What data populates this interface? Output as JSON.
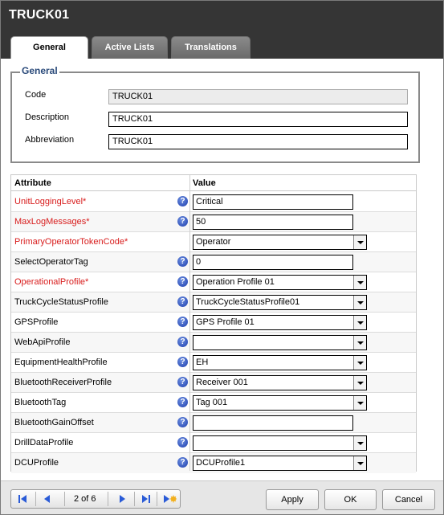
{
  "window": {
    "title": "TRUCK01"
  },
  "tabs": [
    {
      "label": "General",
      "active": true
    },
    {
      "label": "Active Lists",
      "active": false
    },
    {
      "label": "Translations",
      "active": false
    }
  ],
  "general_group": {
    "legend": "General",
    "fields": [
      {
        "label": "Code",
        "value": "TRUCK01",
        "readonly": true
      },
      {
        "label": "Description",
        "value": "TRUCK01",
        "readonly": false
      },
      {
        "label": "Abbreviation",
        "value": "TRUCK01",
        "readonly": false
      }
    ]
  },
  "attributes": {
    "headers": {
      "attribute": "Attribute",
      "value": "Value"
    },
    "rows": [
      {
        "name": "UnitLoggingLevel*",
        "required": true,
        "value": "Critical",
        "control": "input"
      },
      {
        "name": "MaxLogMessages*",
        "required": true,
        "value": "50",
        "control": "input"
      },
      {
        "name": "PrimaryOperatorTokenCode*",
        "required": true,
        "value": "Operator",
        "control": "select",
        "help": false
      },
      {
        "name": "SelectOperatorTag",
        "required": false,
        "value": "0",
        "control": "input"
      },
      {
        "name": "OperationalProfile*",
        "required": true,
        "value": "Operation Profile 01",
        "control": "select"
      },
      {
        "name": "TruckCycleStatusProfile",
        "required": false,
        "value": "TruckCycleStatusProfile01",
        "control": "select"
      },
      {
        "name": "GPSProfile",
        "required": false,
        "value": "GPS Profile 01",
        "control": "select"
      },
      {
        "name": "WebApiProfile",
        "required": false,
        "value": "",
        "control": "select"
      },
      {
        "name": "EquipmentHealthProfile",
        "required": false,
        "value": "EH",
        "control": "select"
      },
      {
        "name": "BluetoothReceiverProfile",
        "required": false,
        "value": "Receiver 001",
        "control": "select"
      },
      {
        "name": "BluetoothTag",
        "required": false,
        "value": "Tag 001",
        "control": "select"
      },
      {
        "name": "BluetoothGainOffset",
        "required": false,
        "value": "",
        "control": "input"
      },
      {
        "name": "DrillDataProfile",
        "required": false,
        "value": "",
        "control": "select"
      },
      {
        "name": "DCUProfile",
        "required": false,
        "value": "DCUProfile1",
        "control": "select"
      }
    ],
    "help_glyph": "?"
  },
  "pager": {
    "text": "2 of 6"
  },
  "buttons": {
    "apply": "Apply",
    "ok": "OK",
    "cancel": "Cancel"
  },
  "icons": {
    "first": "first-page-icon",
    "prev": "previous-page-icon",
    "next": "next-page-icon",
    "last": "last-page-icon",
    "new": "new-record-icon",
    "help": "help-icon",
    "dropdown": "chevron-down-icon"
  },
  "colors": {
    "titlebar": "#353535",
    "required": "#d81c1c",
    "legend": "#2a4a7a",
    "help_icon": "#1e3fae",
    "pager_arrows": "#2a5bd7"
  }
}
